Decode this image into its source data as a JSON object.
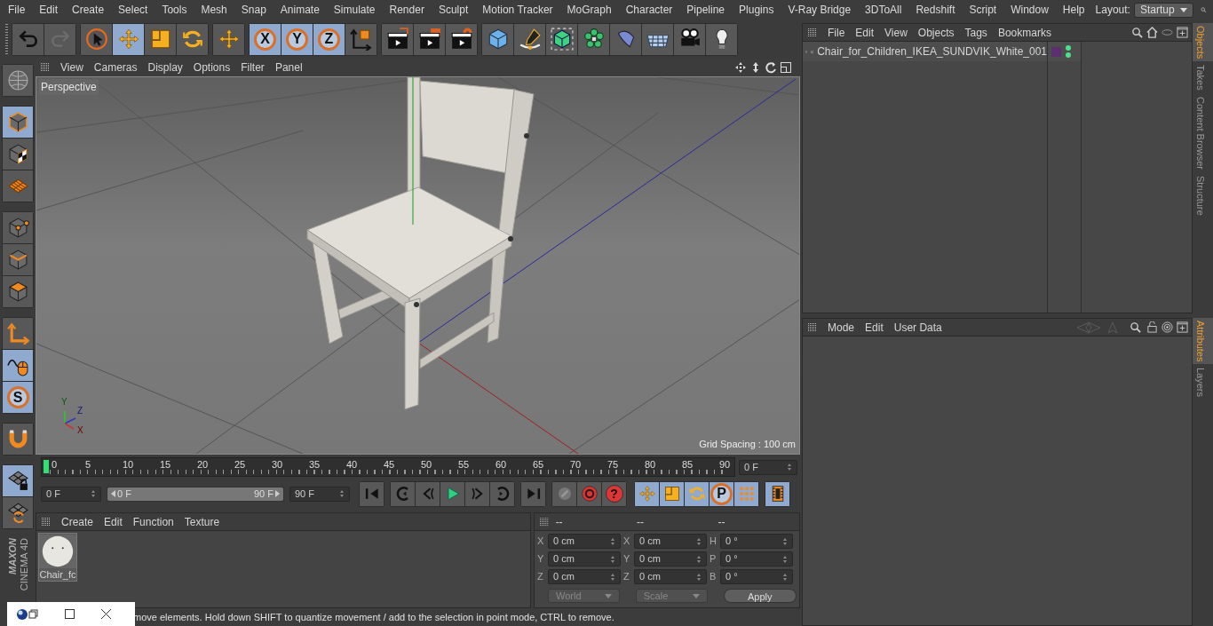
{
  "menu_bar": {
    "items": [
      "File",
      "Edit",
      "Create",
      "Select",
      "Tools",
      "Mesh",
      "Snap",
      "Animate",
      "Simulate",
      "Render",
      "Sculpt",
      "Motion Tracker",
      "MoGraph",
      "Character",
      "Pipeline",
      "Plugins",
      "V-Ray Bridge",
      "3DToAll",
      "Redshift",
      "Script",
      "Window",
      "Help"
    ],
    "layout_label": "Layout:",
    "layout_value": "Startup"
  },
  "toolbar": {
    "groups": [
      [
        {
          "kind": "undo",
          "selected": false
        },
        {
          "kind": "redo",
          "selected": false
        }
      ],
      [
        {
          "kind": "live-select",
          "selected": false
        },
        {
          "kind": "move",
          "selected": true
        },
        {
          "kind": "scale",
          "selected": false
        },
        {
          "kind": "rotate",
          "selected": false
        }
      ],
      [
        {
          "kind": "transform",
          "selected": false
        }
      ],
      [
        {
          "kind": "axis-lock",
          "label": "X",
          "selected": true
        },
        {
          "kind": "axis-lock",
          "label": "Y",
          "selected": true
        },
        {
          "kind": "axis-lock",
          "label": "Z",
          "selected": true
        },
        {
          "kind": "coordinates",
          "selected": false
        }
      ],
      [
        {
          "kind": "render-view",
          "selected": false
        },
        {
          "kind": "render-picture",
          "selected": false
        },
        {
          "kind": "render-settings",
          "selected": false
        }
      ],
      [
        {
          "kind": "cube",
          "selected": false
        },
        {
          "kind": "pen",
          "selected": false
        },
        {
          "kind": "subdivision",
          "selected": false
        },
        {
          "kind": "cloner",
          "selected": false
        },
        {
          "kind": "deformer",
          "selected": false
        },
        {
          "kind": "floor",
          "selected": false
        },
        {
          "kind": "camera",
          "selected": false
        },
        {
          "kind": "light",
          "selected": false
        }
      ]
    ]
  },
  "left_toolbar": {
    "groups": [
      [
        {
          "kind": "globe",
          "selected": false
        }
      ],
      [
        {
          "kind": "model",
          "selected": true
        },
        {
          "kind": "texture",
          "selected": false
        },
        {
          "kind": "workplane",
          "selected": false
        }
      ],
      [
        {
          "kind": "points",
          "selected": false
        },
        {
          "kind": "edges",
          "selected": false
        },
        {
          "kind": "polygons",
          "selected": false
        }
      ],
      [
        {
          "kind": "axis",
          "selected": false
        },
        {
          "kind": "tweak",
          "selected": true
        },
        {
          "kind": "snap",
          "label": "S",
          "selected": true
        }
      ],
      [
        {
          "kind": "magnet",
          "selected": false
        }
      ],
      [
        {
          "kind": "grid-lock",
          "selected": true
        },
        {
          "kind": "grid-rotate",
          "selected": false
        }
      ]
    ]
  },
  "logo": {
    "brand": "MAXON",
    "product": "CINEMA 4D"
  },
  "viewport": {
    "menu": [
      "View",
      "Cameras",
      "Display",
      "Options",
      "Filter",
      "Panel"
    ],
    "camera_label": "Perspective",
    "grid_spacing": "Grid Spacing : 100 cm",
    "axis_labels": [
      "Y",
      "Z",
      "X"
    ]
  },
  "timeline": {
    "ticks": [
      "0",
      "5",
      "10",
      "15",
      "20",
      "25",
      "30",
      "35",
      "40",
      "45",
      "50",
      "55",
      "60",
      "65",
      "70",
      "75",
      "80",
      "85",
      "90"
    ],
    "current_frame": "0 F",
    "start_field": "0 F",
    "range": {
      "start": "0 F",
      "end": "90 F",
      "level": 1
    },
    "end_field": "90 F",
    "controls": [
      [
        {
          "kind": "first"
        }
      ],
      [
        {
          "kind": "prev-key"
        },
        {
          "kind": "prev-frame"
        },
        {
          "kind": "play"
        },
        {
          "kind": "next-frame"
        },
        {
          "kind": "next-key"
        }
      ],
      [
        {
          "kind": "last"
        }
      ],
      [
        {
          "kind": "keyframe",
          "selected": false
        },
        {
          "kind": "autokey",
          "selected": false
        },
        {
          "kind": "help",
          "label": "?",
          "selected": false
        }
      ],
      [
        {
          "kind": "key-move",
          "selected": true
        },
        {
          "kind": "key-scale",
          "selected": true
        },
        {
          "kind": "key-rotate",
          "selected": true
        },
        {
          "kind": "param-key",
          "label": "P",
          "selected": true
        },
        {
          "kind": "pla",
          "selected": true
        }
      ],
      [
        {
          "kind": "film",
          "selected": true
        }
      ]
    ]
  },
  "materials": {
    "menu": [
      "Create",
      "Edit",
      "Function",
      "Texture"
    ],
    "items": [
      {
        "name": "Chair_fc"
      }
    ]
  },
  "coordinates": {
    "headers": [
      "--",
      "--",
      "--"
    ],
    "rows": [
      [
        {
          "label": "X",
          "value": "0 cm"
        },
        {
          "label": "X",
          "value": "0 cm"
        },
        {
          "label": "H",
          "value": "0 °"
        }
      ],
      [
        {
          "label": "Y",
          "value": "0 cm"
        },
        {
          "label": "Y",
          "value": "0 cm"
        },
        {
          "label": "P",
          "value": "0 °"
        }
      ],
      [
        {
          "label": "Z",
          "value": "0 cm"
        },
        {
          "label": "Z",
          "value": "0 cm"
        },
        {
          "label": "B",
          "value": "0 °"
        }
      ]
    ],
    "dropdowns": [
      "World",
      "Scale"
    ],
    "apply": "Apply"
  },
  "status_bar": "move elements. Hold down SHIFT to quantize movement / add to the selection in point mode, CTRL to remove.",
  "objects_panel": {
    "menu": [
      "File",
      "Edit",
      "View",
      "Objects",
      "Tags",
      "Bookmarks"
    ],
    "objects": [
      {
        "name": "Chair_for_Children_IKEA_SUNDVIK_White_001",
        "color": "#5c2f6e",
        "visible_editor": true,
        "visible_render": true
      }
    ]
  },
  "attributes_panel": {
    "menu": [
      "Mode",
      "Edit",
      "User Data"
    ]
  },
  "side_tabs_top": [
    {
      "label": "Objects",
      "selected": true
    },
    {
      "label": "Takes",
      "selected": false
    },
    {
      "label": "Content Browser",
      "selected": false
    },
    {
      "label": "Structure",
      "selected": false
    }
  ],
  "side_tabs_bottom": [
    {
      "label": "Attributes",
      "selected": true
    },
    {
      "label": "Layers",
      "selected": false
    }
  ]
}
